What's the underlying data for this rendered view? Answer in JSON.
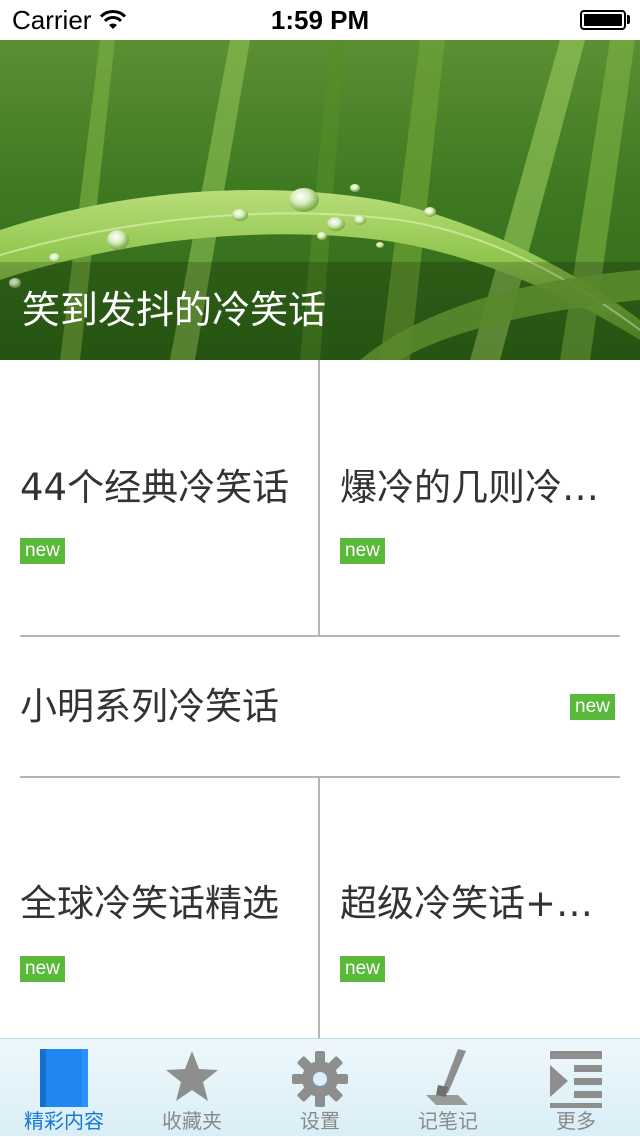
{
  "status_bar": {
    "carrier": "Carrier",
    "time": "1:59 PM",
    "battery_level": 1.0
  },
  "hero": {
    "title": "笑到发抖的冷笑话"
  },
  "grid": {
    "items": [
      {
        "title": "44个经典冷笑话",
        "badge": "new"
      },
      {
        "title": "爆冷的几则冷笑话",
        "badge": "new"
      },
      {
        "title": "小明系列冷笑话",
        "badge": "new"
      },
      {
        "title": "全球冷笑话精选",
        "badge": "new"
      },
      {
        "title": "超级冷笑话+超级冷笑话",
        "badge": "new"
      }
    ]
  },
  "tab_bar": {
    "active_index": 0,
    "tabs": [
      {
        "label": "精彩内容",
        "icon": "book-icon"
      },
      {
        "label": "收藏夹",
        "icon": "star-icon"
      },
      {
        "label": "设置",
        "icon": "gear-icon"
      },
      {
        "label": "记笔记",
        "icon": "pen-icon"
      },
      {
        "label": "更多",
        "icon": "list-more-icon"
      }
    ]
  },
  "colors": {
    "badge": "#5ab83a",
    "active_tab": "#1778d8",
    "inactive_tab": "#8a8a8a",
    "divider": "#b5b5b5"
  }
}
